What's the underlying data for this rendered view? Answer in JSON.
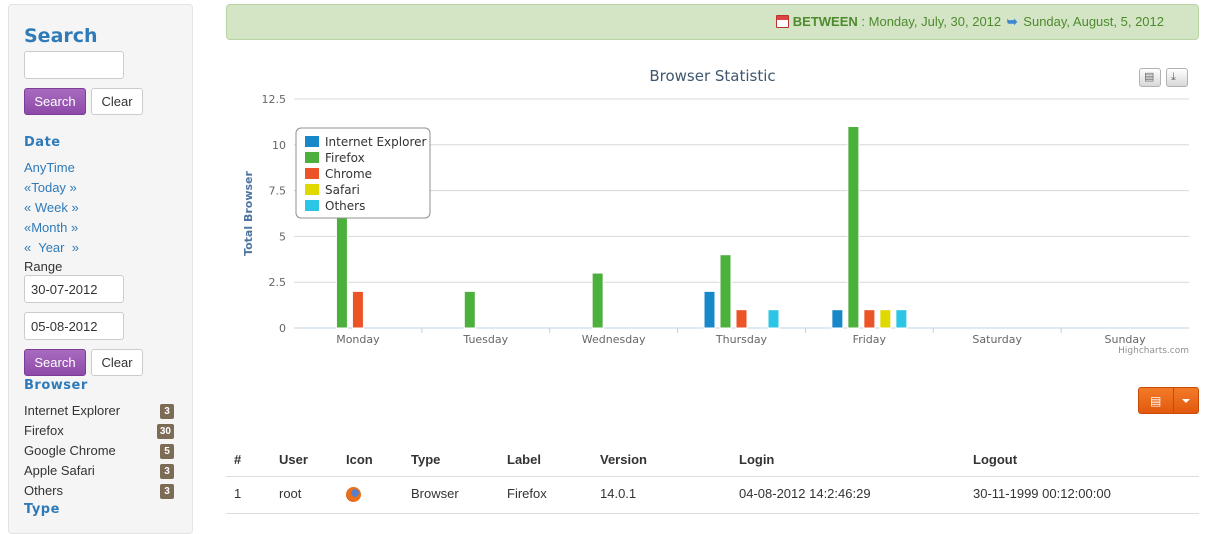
{
  "sidebar": {
    "search_title": "Search",
    "search_value": "",
    "search_button": "Search",
    "clear_button": "Clear",
    "date_title": "Date",
    "date_links": [
      "AnyTime",
      "«Today »",
      "« Week »",
      "«Month »",
      "«  Year  »"
    ],
    "range_label": "Range",
    "range_from": "30-07-2012",
    "range_to": "05-08-2012",
    "search_button_2": "Search",
    "clear_button_2": "Clear",
    "browser_title": "Browser",
    "browsers": [
      {
        "label": "Internet Explorer",
        "count": "3"
      },
      {
        "label": "Firefox",
        "count": "30"
      },
      {
        "label": "Google Chrome",
        "count": "5"
      },
      {
        "label": "Apple Safari",
        "count": "3"
      },
      {
        "label": "Others",
        "count": "3"
      }
    ],
    "type_title": "Type"
  },
  "banner": {
    "between_label": "BETWEEN",
    "separator": ":",
    "start_date": "Monday, July, 30, 2012",
    "end_date": "Sunday, August, 5, 2012",
    "calendar_icon": "calendar-icon",
    "arrow_icon": "arrow-right-icon",
    "text_color": "#4f8a2f",
    "bg_color": "#d3e5c4"
  },
  "chart_data": {
    "type": "bar",
    "title": "Browser Statistic",
    "xlabel": "",
    "ylabel": "Total Browser",
    "ylim": [
      0,
      12.5
    ],
    "yticks": [
      "0",
      "2.5",
      "5",
      "7.5",
      "10",
      "12.5"
    ],
    "categories": [
      "Monday",
      "Tuesday",
      "Wednesday",
      "Thursday",
      "Friday",
      "Saturday",
      "Sunday"
    ],
    "series": [
      {
        "name": "Internet Explorer",
        "color": "#1788c8",
        "values": [
          0,
          0,
          0,
          2,
          1,
          0,
          0
        ]
      },
      {
        "name": "Firefox",
        "color": "#4cb03c",
        "values": [
          9,
          2,
          3,
          4,
          11,
          0,
          0
        ]
      },
      {
        "name": "Chrome",
        "color": "#ec5326",
        "values": [
          2,
          0,
          0,
          1,
          1,
          0,
          0
        ]
      },
      {
        "name": "Safari",
        "color": "#e1d800",
        "values": [
          0,
          0,
          0,
          0,
          1,
          0,
          0
        ]
      },
      {
        "name": "Others",
        "color": "#2bc6e6",
        "values": [
          0,
          0,
          0,
          1,
          1,
          0,
          0
        ]
      }
    ],
    "legend_position": "top-left",
    "grid": true,
    "credits": "Highcharts.com"
  },
  "chart_tools": [
    "print-icon",
    "download-icon"
  ],
  "table": {
    "columns": [
      "#",
      "User",
      "Icon",
      "Type",
      "Label",
      "Version",
      "Login",
      "Logout"
    ],
    "rows": [
      {
        "num": "1",
        "user": "root",
        "icon": "firefox-icon",
        "type": "Browser",
        "label": "Firefox",
        "version": "14.0.1",
        "login": "04-08-2012 14:2:46:29",
        "logout": "30-11-1999 00:12:00:00"
      }
    ]
  },
  "accent_colors": {
    "link": "#2f7ab8",
    "purple_button": "#9b59b6",
    "orange_button": "#e2590e"
  }
}
